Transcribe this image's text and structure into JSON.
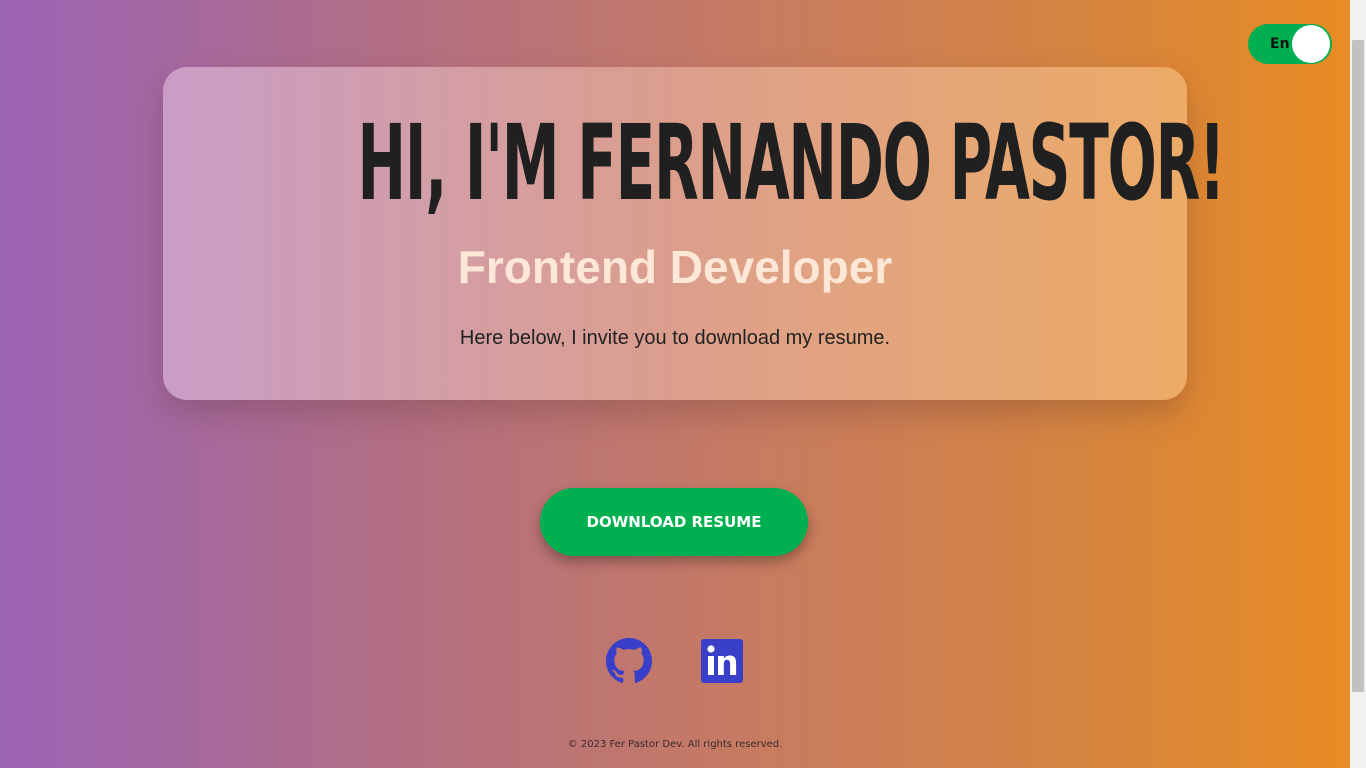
{
  "language_toggle": {
    "label": "En",
    "color": "#00b050"
  },
  "hero": {
    "title": "HI, I'M FERNANDO PASTOR!",
    "subtitle": "Frontend Developer",
    "text": "Here below, I invite you to download my resume."
  },
  "actions": {
    "download_label": "DOWNLOAD RESUME",
    "button_color": "#00b050"
  },
  "social": {
    "items": [
      {
        "name": "github",
        "icon": "github-icon"
      },
      {
        "name": "linkedin",
        "icon": "linkedin-icon"
      }
    ],
    "icon_color": "#3a3fc9"
  },
  "footer": {
    "text": "© 2023 Fer Pastor Dev. All rights reserved."
  },
  "theme": {
    "gradient": [
      "#9b64b5",
      "#b36f82",
      "#c77b62",
      "#d6853f",
      "#ea8c22"
    ]
  }
}
